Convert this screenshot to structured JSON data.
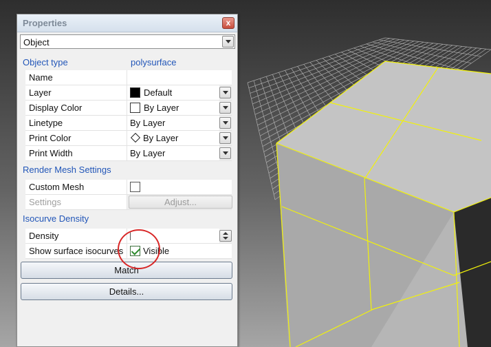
{
  "panel": {
    "title": "Properties",
    "close_symbol": "x",
    "object_selector": "Object"
  },
  "object_type": {
    "label": "Object type",
    "value": "polysurface"
  },
  "properties": [
    {
      "label": "Name",
      "value": ""
    },
    {
      "label": "Layer",
      "value": "Default",
      "swatch": "#000000"
    },
    {
      "label": "Display Color",
      "value": "By Layer",
      "swatch": "#ffffff"
    },
    {
      "label": "Linetype",
      "value": "By Layer"
    },
    {
      "label": "Print Color",
      "value": "By Layer",
      "icon": "diamond-icon"
    },
    {
      "label": "Print Width",
      "value": "By Layer"
    }
  ],
  "render_mesh": {
    "header": "Render Mesh Settings",
    "custom_mesh_label": "Custom Mesh",
    "custom_mesh_checked": false,
    "settings_label": "Settings",
    "adjust_label": "Adjust..."
  },
  "isocurve": {
    "header": "Isocurve Density",
    "density_label": "Density",
    "density_value": "",
    "show_label": "Show surface isocurves",
    "show_value": "Visible",
    "show_checked": true
  },
  "buttons": {
    "match_label": "Match",
    "details_label": "Details..."
  },
  "colors": {
    "section_header": "#2256b8",
    "wireframe": "#f2f20a",
    "highlight_circle": "#d82626"
  }
}
